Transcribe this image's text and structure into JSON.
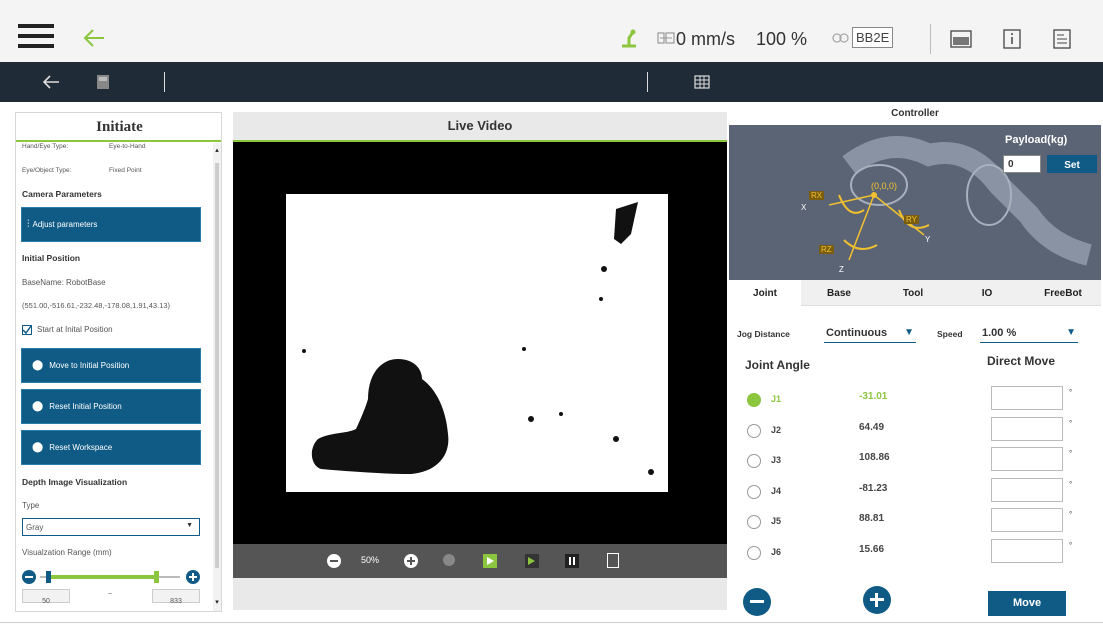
{
  "topbar": {
    "speed_text": "0 mm/s",
    "percent_text": "100 %",
    "model_badge": "BB2E",
    "accent": "#8cc63f"
  },
  "left": {
    "title": "Initiate",
    "hand_eye_label": "Hand/Eye Type:",
    "hand_eye_value": "Eye-to-Hand",
    "eye_object_label": "Eye/Object Type:",
    "eye_object_value": "Fixed Point",
    "camera_params_heading": "Camera Parameters",
    "adjust_btn": "Adjust parameters",
    "initial_position_heading": "Initial Position",
    "basename": "BaseName: RobotBase",
    "coords": "(551.00,-516.61,-232.48,-178.08,1.91,43.13)",
    "start_checkbox_label": "Start at Inital Position",
    "move_initial_btn": "Move to Initial Position",
    "reset_initial_btn": "Reset Initial Position",
    "reset_workspace_btn": "Reset Workspace",
    "depth_heading": "Depth Image Visualization",
    "type_label": "Type",
    "type_value": "Gray",
    "range_label": "Visualzation Range (mm)",
    "range_min": "50",
    "range_tilde": "~",
    "range_max": "833",
    "range_low_fraction": 0.06,
    "range_high_fraction": 0.83
  },
  "video": {
    "title": "Live Video",
    "zoom": "50%"
  },
  "controller": {
    "title": "Controller",
    "payload_label": "Payload(kg)",
    "payload_value": "0",
    "set_btn": "Set",
    "axis_labels": {
      "rx": "RX",
      "ry": "RY",
      "rz": "RZ",
      "x": "X",
      "y": "Y",
      "z": "Z",
      "origin": "(0,0,0)"
    },
    "tabs": [
      "Joint",
      "Base",
      "Tool",
      "IO",
      "FreeBot"
    ],
    "jog_distance_label": "Jog Distance",
    "jog_distance_value": "Continuous",
    "speed_label": "Speed",
    "speed_value": "1.00 %",
    "joint_angle_heading": "Joint Angle",
    "direct_move_heading": "Direct Move",
    "joints": [
      {
        "name": "J1",
        "value": "-31.01",
        "selected": true
      },
      {
        "name": "J2",
        "value": "64.49",
        "selected": false
      },
      {
        "name": "J3",
        "value": "108.86",
        "selected": false
      },
      {
        "name": "J4",
        "value": "-81.23",
        "selected": false
      },
      {
        "name": "J5",
        "value": "88.81",
        "selected": false
      },
      {
        "name": "J6",
        "value": "15.66",
        "selected": false
      }
    ],
    "degree_symbol": "°",
    "move_btn": "Move"
  }
}
